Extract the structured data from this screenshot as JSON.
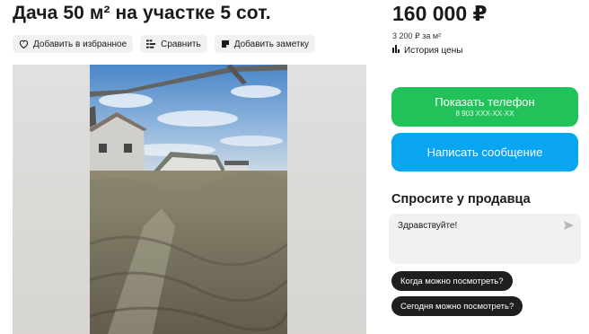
{
  "listing": {
    "title": "Дача 50 м² на участке 5 сот."
  },
  "actions": {
    "favorite_label": "Добавить в избранное",
    "compare_label": "Сравнить",
    "note_label": "Добавить заметку"
  },
  "price": {
    "value": "160 000 ₽",
    "per_m2": "3 200 ₽ за м²",
    "history_label": "История цены"
  },
  "contact": {
    "phone_button_label": "Показать телефон",
    "phone_masked": "8 903 XXX-XX-XX",
    "message_button_label": "Написать сообщение"
  },
  "ask_seller": {
    "title": "Спросите у продавца",
    "message_text": "Здравствуйте!",
    "quick_questions": [
      "Когда можно посмотреть?",
      "Сегодня можно посмотреть?"
    ]
  },
  "icons": {
    "favorite": "heart-icon",
    "compare": "compare-icon",
    "note": "note-icon",
    "history": "bar-chart-icon",
    "send": "send-icon"
  },
  "colors": {
    "phone_button": "#22c25a",
    "message_button": "#0aa5f0",
    "chip_bg": "#f2f1f0",
    "quick_question_bg": "#1f1f1f"
  }
}
